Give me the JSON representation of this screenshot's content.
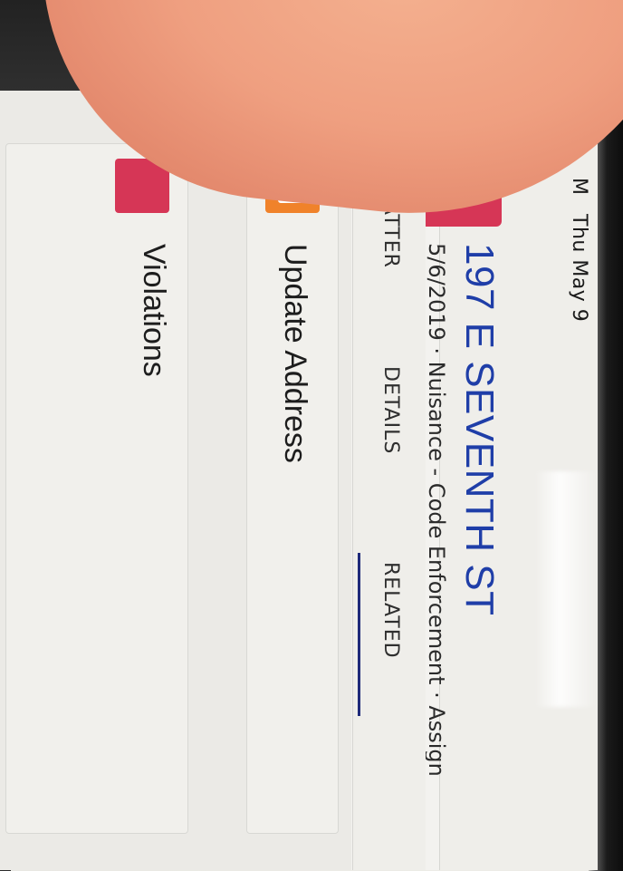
{
  "status_bar": {
    "time_fragment": "M",
    "date": "Thu May 9"
  },
  "record": {
    "title": "197 E SEVENTH ST",
    "subtitle": "5/6/2019 · Nuisance - Code Enforcement · Assign"
  },
  "tabs": [
    {
      "label": "CHATTER"
    },
    {
      "label": "DETAILS"
    },
    {
      "label": "RELATED",
      "active": true
    }
  ],
  "actions": [
    {
      "label": "Update Address",
      "icon": "box-icon",
      "color": "#f0822a"
    },
    {
      "label": "Violations",
      "icon": "record-icon",
      "color": "#d63656"
    }
  ],
  "colors": {
    "accent_red": "#d63656",
    "title_blue": "#1f3ea8",
    "back_arrow_blue": "#2f5fd3",
    "tab_underline": "#1f2a7a"
  }
}
